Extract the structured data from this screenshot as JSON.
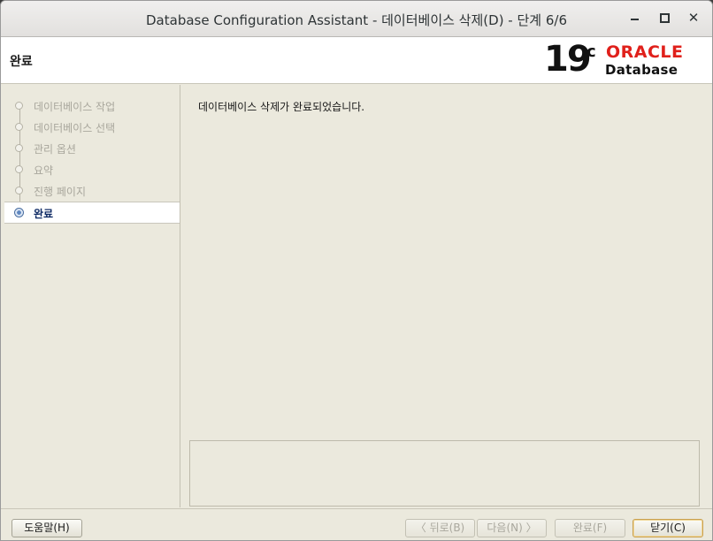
{
  "window": {
    "title": "Database Configuration Assistant - 데이터베이스 삭제(D) - 단계 6/6",
    "close_glyph": "✕"
  },
  "header": {
    "page_title": "완료",
    "brand_version": "19",
    "brand_superscript": "c",
    "brand_name": "ORACLE",
    "brand_product": "Database",
    "brand_color": "#e0201b"
  },
  "nav": {
    "steps": [
      {
        "label": "데이터베이스 작업",
        "state": "done"
      },
      {
        "label": "데이터베이스 선택",
        "state": "done"
      },
      {
        "label": "관리 옵션",
        "state": "done"
      },
      {
        "label": "요약",
        "state": "done"
      },
      {
        "label": "진행 페이지",
        "state": "done"
      },
      {
        "label": "완료",
        "state": "active"
      }
    ]
  },
  "main": {
    "message": "데이터베이스 삭제가 완료되었습니다."
  },
  "footer": {
    "help": "도움말(H)",
    "back": "〈 뒤로(B)",
    "next": "다음(N) 〉",
    "finish": "완료(F)",
    "close": "닫기(C)"
  }
}
